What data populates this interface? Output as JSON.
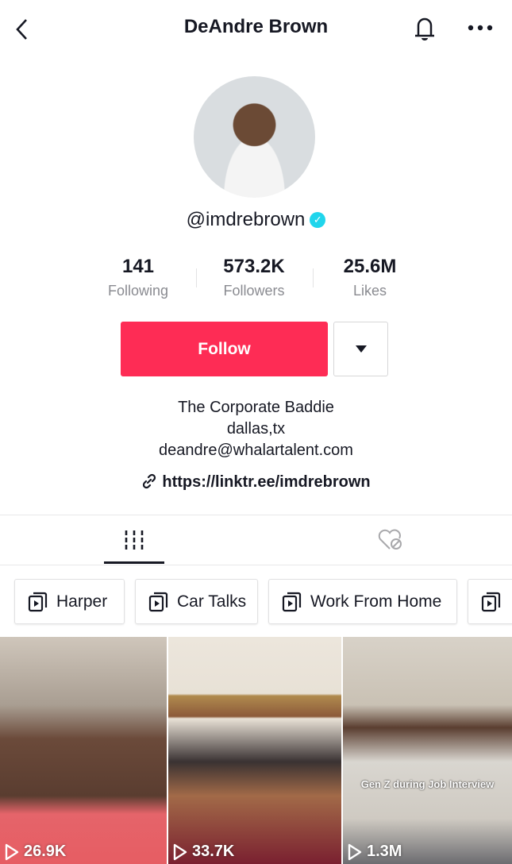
{
  "header": {
    "title": "DeAndre Brown",
    "back_icon": "chevron-left-icon",
    "bell_icon": "bell-icon",
    "more_icon": "more-horizontal-icon"
  },
  "profile": {
    "username": "@imdrebrown",
    "verified": true,
    "verified_color": "#20d5ec"
  },
  "stats": [
    {
      "value": "141",
      "label": "Following"
    },
    {
      "value": "573.2K",
      "label": "Followers"
    },
    {
      "value": "25.6M",
      "label": "Likes"
    }
  ],
  "actions": {
    "follow_label": "Follow",
    "follow_color": "#fe2c55"
  },
  "bio": {
    "lines": [
      "The Corporate Baddie",
      "dallas,tx",
      "deandre@whalartalent.com"
    ],
    "link": "https://linktr.ee/imdrebrown"
  },
  "tabs": [
    {
      "icon": "grid-icon",
      "active": true
    },
    {
      "icon": "liked-hidden-icon",
      "active": false
    }
  ],
  "playlists": [
    {
      "label": "Harper"
    },
    {
      "label": "Car Talks"
    },
    {
      "label": "Work From Home"
    },
    {
      "label": ""
    }
  ],
  "videos": [
    {
      "views": "26.9K",
      "caption": ""
    },
    {
      "views": "33.7K",
      "caption": ""
    },
    {
      "views": "1.3M",
      "caption": "Gen Z during Job Interview"
    }
  ]
}
